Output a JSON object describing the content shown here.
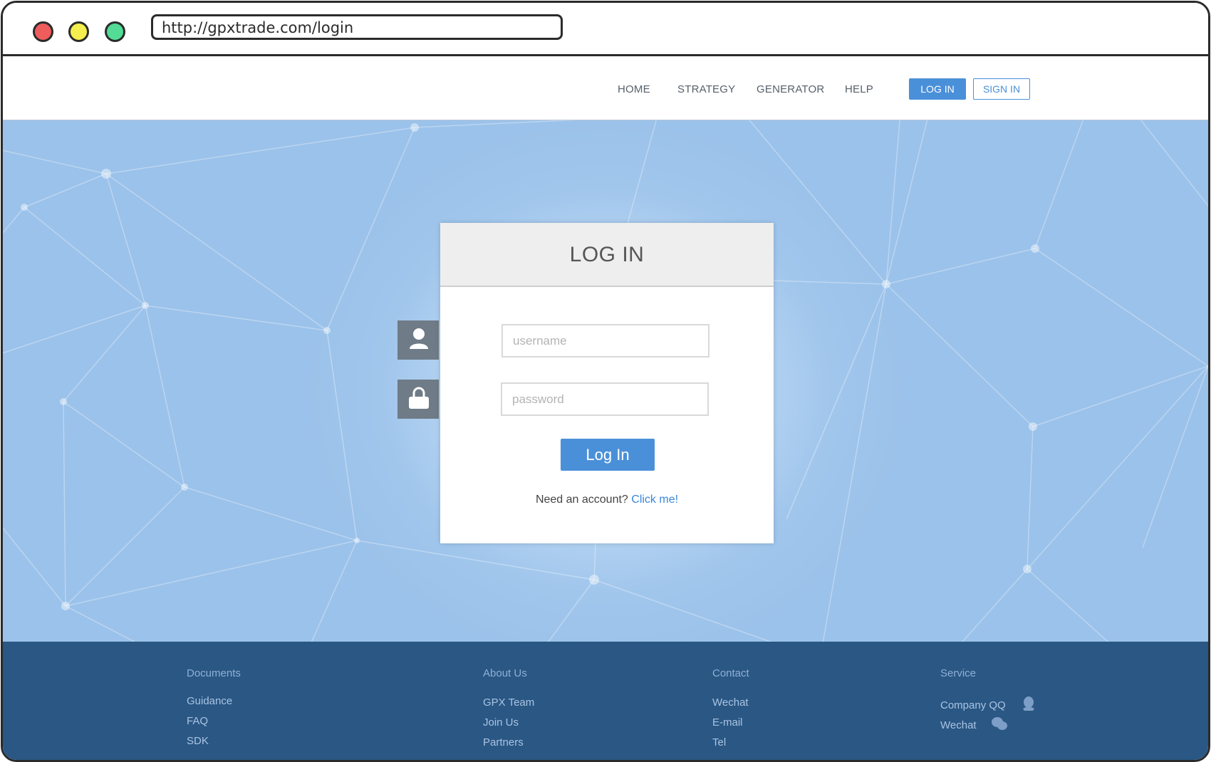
{
  "browser": {
    "url": "http://gpxtrade.com/login"
  },
  "nav": {
    "home": "HOME",
    "strategy": "STRATEGY",
    "generator": "GENERATOR",
    "help": "HELP",
    "login": "LOG IN",
    "signin": "SIGN IN"
  },
  "login_card": {
    "title": "LOG IN",
    "username_placeholder": "username",
    "password_placeholder": "password",
    "submit_label": "Log In",
    "need_account": "Need an account?",
    "click_me": "Click me!"
  },
  "footer": {
    "documents": {
      "heading": "Documents",
      "items": [
        "Guidance",
        "FAQ",
        "SDK"
      ]
    },
    "about": {
      "heading": "About Us",
      "items": [
        "GPX Team",
        "Join Us",
        "Partners"
      ]
    },
    "contact": {
      "heading": "Contact",
      "items": [
        "Wechat",
        "E-mail",
        "Tel"
      ]
    },
    "service": {
      "heading": "Service",
      "items": [
        "Company QQ",
        "Wechat"
      ]
    }
  },
  "icons": {
    "user": "user-icon",
    "lock": "lock-icon",
    "qq": "qq-icon",
    "wechat": "wechat-icon"
  },
  "colors": {
    "accent": "#4a90d9",
    "footer_bg": "#2a5784",
    "hero_bg": "#a1c6ec"
  }
}
